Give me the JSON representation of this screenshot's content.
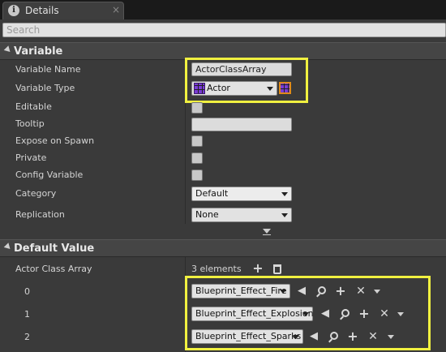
{
  "tab": {
    "icon": "details-info-icon",
    "label": "Details",
    "close": "×"
  },
  "search": {
    "placeholder": "Search"
  },
  "variable_section": {
    "title": "Variable",
    "rows": {
      "variable_name": {
        "label": "Variable Name",
        "value": "ActorClassArray"
      },
      "variable_type": {
        "label": "Variable Type",
        "value": "Actor"
      },
      "editable": {
        "label": "Editable"
      },
      "tooltip": {
        "label": "Tooltip",
        "value": ""
      },
      "expose_on_spawn": {
        "label": "Expose on Spawn"
      },
      "private": {
        "label": "Private"
      },
      "config_variable": {
        "label": "Config Variable"
      },
      "category": {
        "label": "Category",
        "value": "Default"
      },
      "replication": {
        "label": "Replication",
        "value": "None"
      }
    }
  },
  "default_value_section": {
    "title": "Default Value",
    "array": {
      "label": "Actor Class Array",
      "count_text": "3 elements",
      "elements": [
        {
          "index": "0",
          "value": "Blueprint_Effect_Fire"
        },
        {
          "index": "1",
          "value": "Blueprint_Effect_Explosion"
        },
        {
          "index": "2",
          "value": "Blueprint_Effect_Sparks"
        }
      ]
    }
  },
  "colors": {
    "highlight": "#f0f040",
    "type_pin": "#7a3bd6",
    "container_border": "#e08a1a"
  }
}
